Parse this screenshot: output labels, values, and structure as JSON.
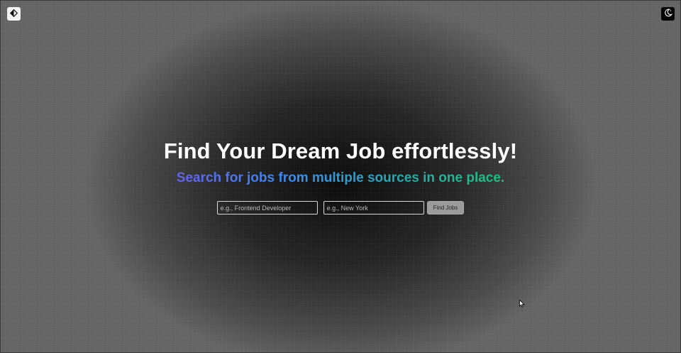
{
  "header": {
    "left_icon": "contrast-icon",
    "right_icon": "moon-icon"
  },
  "hero": {
    "title": "Find Your Dream Job effortlessly!",
    "subtitle": "Search for jobs from multiple sources in one place."
  },
  "search": {
    "job_placeholder": "e.g., Frontend Developer",
    "location_placeholder": "e.g., New York",
    "button_label": "Find Jobs"
  },
  "colors": {
    "subtitle_gradient": [
      "#6462e8",
      "#3b8cf0",
      "#27a7b4",
      "#1fc07c"
    ]
  }
}
